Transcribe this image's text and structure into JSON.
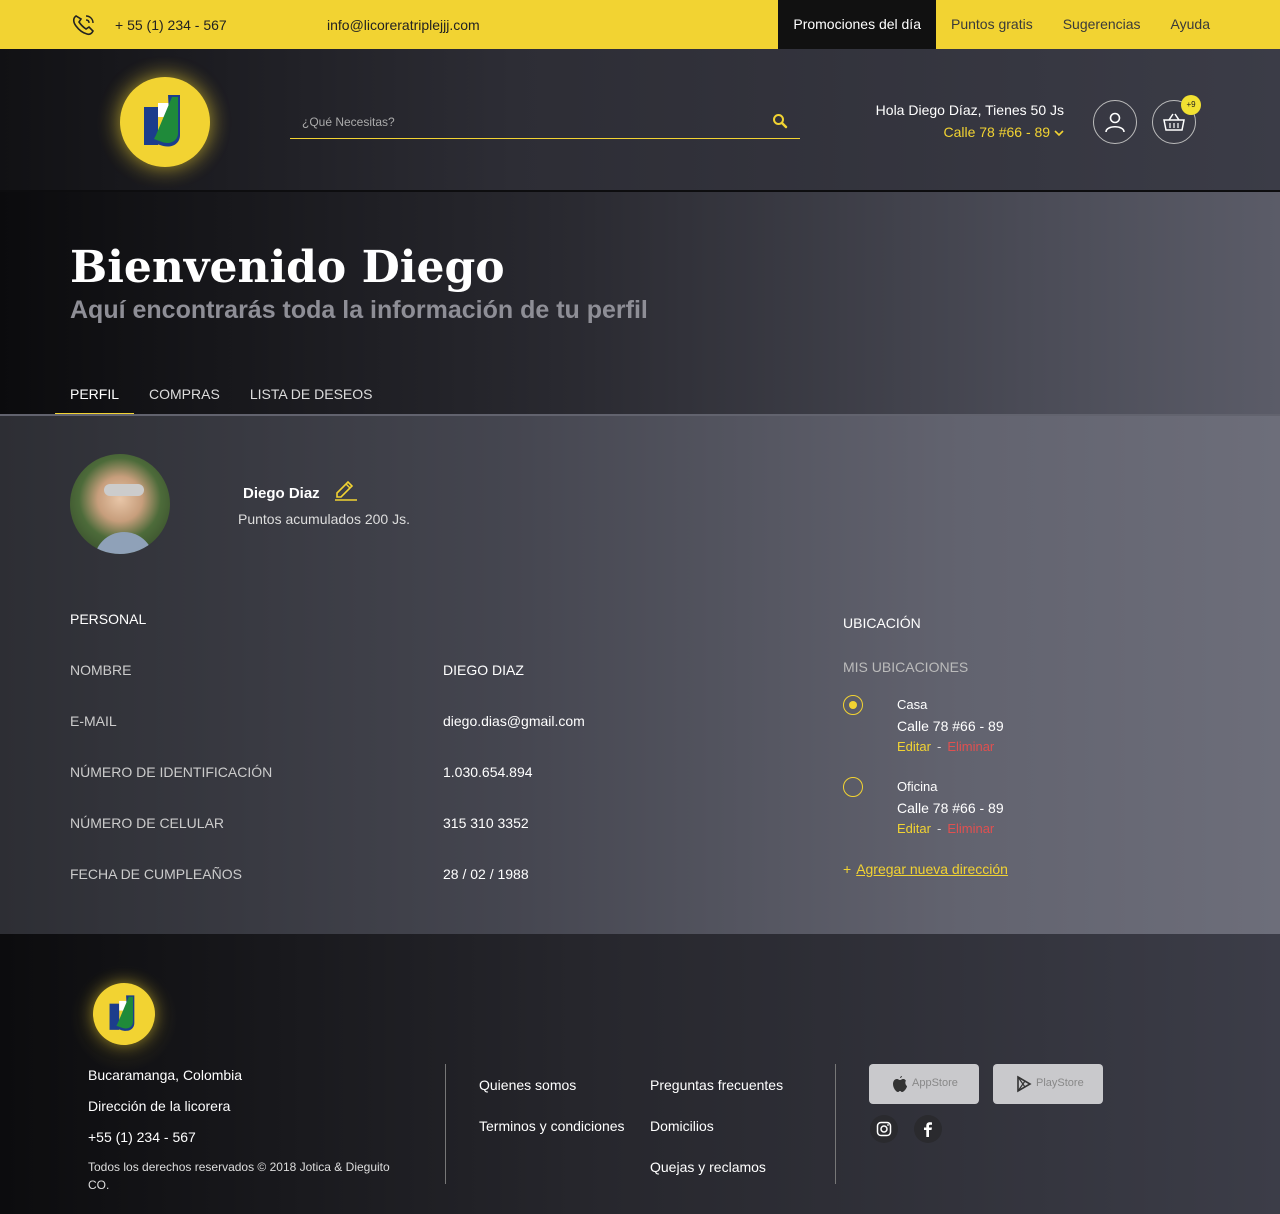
{
  "topbar": {
    "phone": "+ 55 (1) 234 - 567",
    "email": "info@licoreratriplejjj.com",
    "nav": [
      "Promociones del día",
      "Puntos gratis",
      "Sugerencias",
      "Ayuda"
    ]
  },
  "header": {
    "search_placeholder": "¿Qué Necesitas?",
    "greeting": "Hola Diego Díaz, Tienes 50 Js",
    "address": "Calle 78 #66 - 89",
    "cart_badge": "+9"
  },
  "hero": {
    "title": "Bienvenido Diego",
    "subtitle": "Aquí encontrarás toda la información de tu perfil",
    "tabs": [
      "PERFIL",
      "COMPRAS",
      "LISTA DE DESEOS"
    ]
  },
  "profile": {
    "name": "Diego Diaz",
    "points": "Puntos acumulados 200 Js."
  },
  "personal": {
    "title": "PERSONAL",
    "fields": [
      {
        "label": "NOMBRE",
        "value": "DIEGO DIAZ"
      },
      {
        "label": "E-MAIL",
        "value": "diego.dias@gmail.com"
      },
      {
        "label": "NÚMERO DE IDENTIFICACIÓN",
        "value": "1.030.654.894"
      },
      {
        "label": "NÚMERO DE CELULAR",
        "value": "315 310 3352"
      },
      {
        "label": "FECHA DE CUMPLEAÑOS",
        "value": "28 / 02 / 1988"
      }
    ]
  },
  "location": {
    "title": "UBICACIÓN",
    "subtitle": "MIS UBICACIONES",
    "items": [
      {
        "name": "Casa",
        "address": "Calle 78 #66 - 89",
        "edit": "Editar",
        "sep": "-",
        "delete": "Eliminar"
      },
      {
        "name": "Oficina",
        "address": "Calle 78 #66 - 89",
        "edit": "Editar",
        "sep": "-",
        "delete": "Eliminar"
      }
    ],
    "add_plus": "+",
    "add_label": "Agregar nueva dirección"
  },
  "footer": {
    "city": "Bucaramanga, Colombia",
    "address": "Dirección de la licorera",
    "phone": "+55 (1) 234 - 567",
    "copyright": "Todos los derechos reservados © 2018 Jotica & Dieguito CO.",
    "links_col1": [
      "Quienes somos",
      "Terminos y condiciones"
    ],
    "links_col2": [
      "Preguntas frecuentes",
      "Domicilios",
      "Quejas y reclamos"
    ],
    "appstore": "AppStore",
    "playstore": "PlayStore"
  },
  "colors": {
    "accent": "#f2d332",
    "danger": "#e05050",
    "topbar_active": "#111111"
  }
}
